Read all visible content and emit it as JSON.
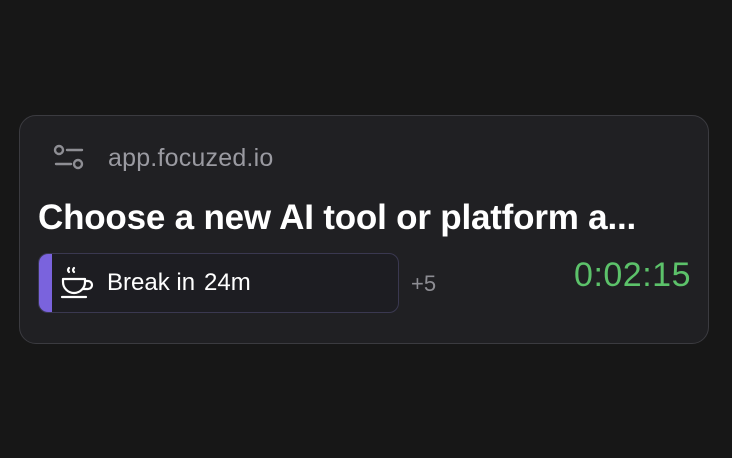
{
  "header": {
    "icon": "settings-sliders-icon",
    "domain": "app.focuzed.io"
  },
  "task": {
    "title": "Choose a new AI tool or platform a..."
  },
  "break_chip": {
    "icon": "coffee-cup-icon",
    "label": "Break in",
    "time": "24m",
    "accent_color": "#7a63dd"
  },
  "more": {
    "label": "+5"
  },
  "timer": {
    "value": "0:02:15",
    "color": "#5cc26a"
  }
}
